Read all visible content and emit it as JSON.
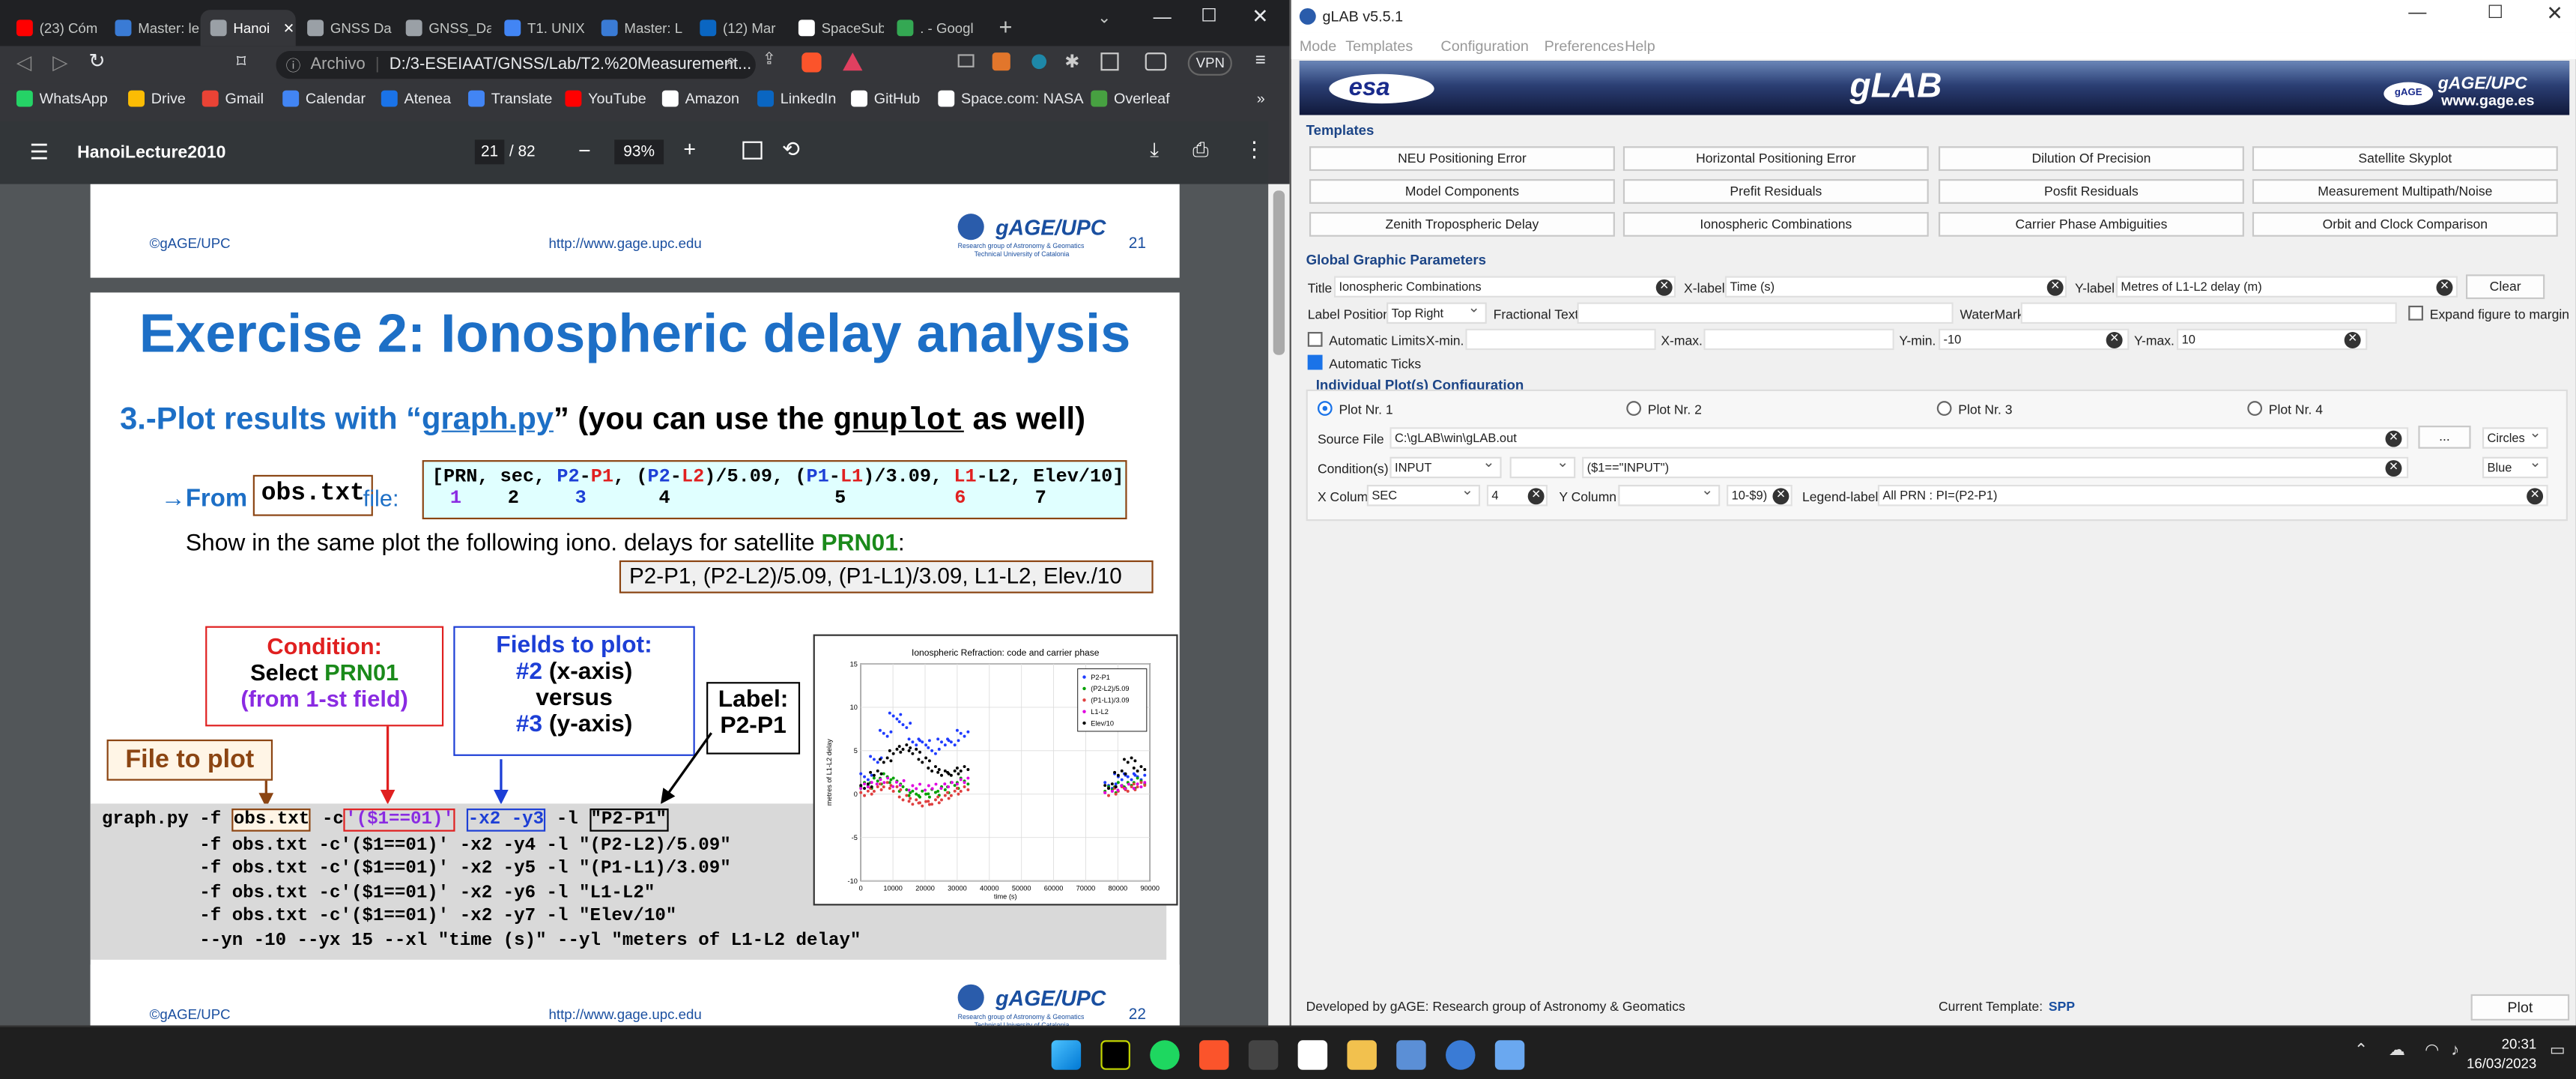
{
  "browser": {
    "tabs": [
      {
        "label": "(23) Cóm",
        "color": "#ff0000"
      },
      {
        "label": "Master: le",
        "color": "#3a7bd5"
      },
      {
        "label": "Hanoi",
        "color": "#9aa0a6",
        "active": true
      },
      {
        "label": "GNSS Da",
        "color": "#9aa0a6"
      },
      {
        "label": "GNSS_Da",
        "color": "#9aa0a6"
      },
      {
        "label": "T1. UNIX",
        "color": "#4285f4"
      },
      {
        "label": "Master: L",
        "color": "#3a7bd5"
      },
      {
        "label": "(12) Mar",
        "color": "#0a66c2"
      },
      {
        "label": "SpaceSub",
        "color": "#ffffff"
      },
      {
        "label": ". - Googl",
        "color": "#34a853"
      }
    ],
    "url_prefix": "Archivo",
    "url": "D:/3-ESEIAAT/GNSS/Lab/T2.%20Measurement...",
    "vpn": "VPN",
    "bookmarks": [
      {
        "label": "WhatsApp",
        "color": "#25d366"
      },
      {
        "label": "Drive",
        "color": "#fbbc04"
      },
      {
        "label": "Gmail",
        "color": "#ea4335"
      },
      {
        "label": "Calendar",
        "color": "#4285f4"
      },
      {
        "label": "Atenea",
        "color": "#1a73e8"
      },
      {
        "label": "Translate",
        "color": "#4285f4"
      },
      {
        "label": "YouTube",
        "color": "#ff0000"
      },
      {
        "label": "Amazon",
        "color": "#ffffff"
      },
      {
        "label": "LinkedIn",
        "color": "#0a66c2"
      },
      {
        "label": "GitHub",
        "color": "#ffffff"
      },
      {
        "label": "Space.com: NASA",
        "color": "#ffffff"
      },
      {
        "label": "Overleaf",
        "color": "#47a141"
      }
    ],
    "more_bookmarks": "»"
  },
  "pdf": {
    "doc_title": "HanoiLecture2010",
    "page_current": "21",
    "page_total": "/ 82",
    "zoom": "93%",
    "page_top": {
      "left": "©gAGE/UPC",
      "url": "http://www.gage.upc.edu",
      "logo": "gAGE/UPC",
      "logo_sub1": "Research group of Astronomy & Geomatics",
      "logo_sub2": "Technical University of Catalonia",
      "num": "21"
    },
    "page_bottom": {
      "left": "©gAGE/UPC",
      "url": "http://www.gage.upc.edu",
      "logo": "gAGE/UPC",
      "logo_sub1": "Research group of Astronomy & Geomatics",
      "logo_sub2": "Technical University of Catalonia",
      "num": "22"
    },
    "slide": {
      "title": "Exercise 2: Ionospheric delay analysis",
      "sub_prefix": "3.-Plot results with “",
      "sub_link": "graph.py",
      "sub_mid": "”  (you can use the ",
      "sub_mono": "gnuplot",
      "sub_end": " as well)",
      "from_arrow": "→From",
      "obs_file": "obs.txt",
      "file_label": " file:",
      "fields_line": "[PRN, sec, P2-P1, (P2-L2)/5.09, (P1-L1)/3.09, L1-L2, Elev/10]",
      "field_nums": [
        "1",
        "2",
        "3",
        "4",
        "5",
        "6",
        "7"
      ],
      "show_text": "Show in the same plot the following iono. delays for satellite ",
      "prn": "PRN01",
      "delays_box": "P2-P1,  (P2-L2)/5.09,  (P1-L1)/3.09, L1-L2,  Elev./10",
      "condition_title": "Condition:",
      "condition_select": "Select  ",
      "condition_prn": "PRN01",
      "condition_sub": "(from 1-st field)",
      "fields_title": "Fields to plot:",
      "fields_l1a": "#2",
      "fields_l1b": " (x-axis)",
      "fields_l2": "versus",
      "fields_l3a": "#3",
      "fields_l3b": " (y-axis)",
      "label_title": "Label:",
      "label_val": "P2-P1",
      "file_to_plot": "File to plot",
      "cmd_lines": [
        "         -f obs.txt -c'($1==01)' -x2 -y4 -l \"(P2-L2)/5.09\"",
        "         -f obs.txt -c'($1==01)' -x2 -y5 -l \"(P1-L1)/3.09\"",
        "         -f obs.txt -c'($1==01)' -x2 -y6 -l \"L1-L2\"",
        "         -f obs.txt -c'($1==01)' -x2 -y7 -l \"Elev/10\"",
        "         --yn -10 --yx 15 --xl \"time (s)\" --yl \"meters of L1-L2 delay\""
      ],
      "cmd_first": {
        "a": "graph.py -f ",
        "b": "obs.txt",
        "c": " -c",
        "d": "'($1==01)'",
        "e": " ",
        "f": "-x2 -y3",
        "g": " -l ",
        "h": "\"P2-P1\""
      }
    },
    "chart_data": {
      "type": "scatter",
      "title": "Ionospheric Refraction: code and carrier phase",
      "xlabel": "time (s)",
      "ylabel": "metres of L1-L2 delay",
      "xlim": [
        0,
        90000
      ],
      "ylim": [
        -10,
        15
      ],
      "xticks": [
        "0",
        "10000",
        "20000",
        "30000",
        "40000",
        "50000",
        "60000",
        "70000",
        "80000",
        "90000"
      ],
      "yticks": [
        "15",
        "10",
        "5",
        "0",
        "-5",
        "-10"
      ],
      "legend_position": "top-right",
      "series": [
        {
          "name": "P2-P1",
          "color": "#1f3cff",
          "x": [
            0,
            3000,
            6000,
            9000,
            12000,
            15000,
            18000,
            21000,
            24000,
            27000,
            30000,
            76000,
            79000,
            82000,
            85000
          ],
          "y": [
            2,
            4,
            7,
            9,
            8,
            6,
            6,
            5,
            6,
            6,
            7,
            1,
            2,
            2,
            2
          ]
        },
        {
          "name": "(P2-L2)/5.09",
          "color": "#00a000",
          "x": [
            0,
            3000,
            6000,
            9000,
            12000,
            15000,
            18000,
            21000,
            24000,
            27000,
            30000,
            76000,
            79000,
            82000,
            85000
          ],
          "y": [
            1,
            1.5,
            2,
            1.5,
            0.5,
            0,
            0,
            0.2,
            0.5,
            1,
            1.5,
            0.5,
            1,
            1,
            1.5
          ]
        },
        {
          "name": "(P1-L1)/3.09",
          "color": "#e04040",
          "x": [
            0,
            3000,
            6000,
            9000,
            12000,
            15000,
            18000,
            21000,
            24000,
            27000,
            30000,
            76000,
            79000,
            82000,
            85000
          ],
          "y": [
            0,
            0.5,
            1,
            0.5,
            -0.5,
            -1,
            -1.2,
            -1,
            -0.5,
            0,
            0.5,
            0,
            0.5,
            0.5,
            1
          ]
        },
        {
          "name": "L1-L2",
          "color": "#e000e0",
          "x": [
            0,
            5000,
            10000,
            15000,
            20000,
            25000,
            30000,
            76000,
            80000,
            85000
          ],
          "y": [
            1,
            1.5,
            1.2,
            0.8,
            0.8,
            1,
            1.5,
            0.5,
            0.8,
            1
          ]
        },
        {
          "name": "Elev/10",
          "color": "#000000",
          "x": [
            0,
            3000,
            6000,
            9000,
            12000,
            15000,
            18000,
            21000,
            24000,
            27000,
            30000,
            76000,
            79000,
            82000,
            85000
          ],
          "y": [
            1,
            2.5,
            4,
            5,
            5.5,
            5,
            4,
            3,
            2.5,
            2.5,
            3,
            1,
            2.5,
            4,
            3
          ]
        }
      ]
    }
  },
  "glab": {
    "title": "gLAB v5.5.1",
    "menu": [
      "Mode",
      "Templates",
      "Configuration",
      "Preferences",
      "Help"
    ],
    "banner_left": "esa",
    "banner_center": "gLAB",
    "banner_right": "gAGE/UPC",
    "banner_right_url": "www.gage.es",
    "banner_right_badge": "gAGE",
    "templates_title": "Templates",
    "templates": [
      [
        "NEU Positioning Error",
        "Horizontal Positioning Error",
        "Dilution Of Precision",
        "Satellite Skyplot"
      ],
      [
        "Model Components",
        "Prefit Residuals",
        "Posfit Residuals",
        "Measurement Multipath/Noise"
      ],
      [
        "Zenith Tropospheric Delay",
        "Ionospheric Combinations",
        "Carrier Phase Ambiguities",
        "Orbit and Clock Comparison"
      ]
    ],
    "global_title": "Global Graphic Parameters",
    "title_label": "Title",
    "title_value": "Ionospheric Combinations",
    "xlabel_label": "X-label",
    "xlabel_value": "Time (s)",
    "ylabel_label": "Y-label",
    "ylabel_value": "Metres of L1-L2 delay (m)",
    "clear": "Clear",
    "label_position_label": "Label Position",
    "label_position_value": "Top Right",
    "fractional_text": "Fractional Text",
    "watermark": "WaterMark",
    "expand": "Expand figure to margin",
    "auto_limits": "Automatic Limits",
    "xmin_label": "X-min.",
    "xmax_label": "X-max.",
    "ymin_label": "Y-min.",
    "ymin_value": "-10",
    "ymax_label": "Y-max.",
    "ymax_value": "10",
    "auto_ticks": "Automatic Ticks",
    "individual_title": "Individual Plot(s) Configuration",
    "plots": [
      "Plot Nr. 1",
      "Plot Nr. 2",
      "Plot Nr. 3",
      "Plot Nr. 4"
    ],
    "source_label": "Source File",
    "source_value": "C:\\gLAB\\win\\gLAB.out",
    "browse": "...",
    "marker": "Circles",
    "condition_label": "Condition(s)",
    "condition_sel": "INPUT",
    "condition_value": "($1==\"INPUT\")",
    "color": "Blue",
    "xcol_label": "X Colum",
    "xcol_sel": "SEC",
    "xcol_value": "4",
    "ycol_label": "Y Column",
    "ycol_value": "10-$9)",
    "legend_label": "Legend-label",
    "legend_value": "All PRN : PI=(P2-P1)",
    "footer": "Developed by gAGE: Research group of Astronomy & Geomatics",
    "current_template_label": "Current Template:",
    "current_template": "SPP",
    "plot_button": "Plot"
  },
  "taskbar": {
    "time": "20:31",
    "date": "16/03/2023"
  }
}
